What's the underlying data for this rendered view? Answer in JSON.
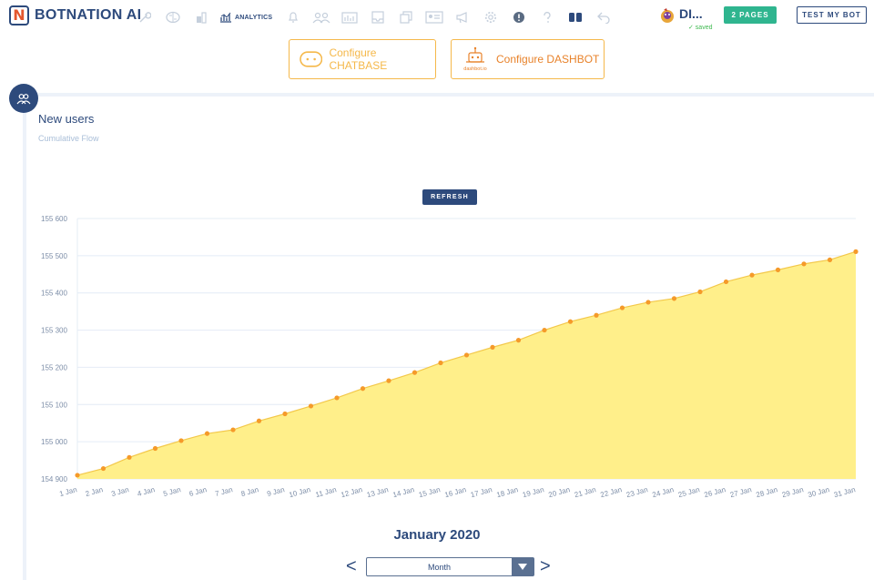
{
  "brand": {
    "name": "BOTNATION AI",
    "mark": "N"
  },
  "toolbar": {
    "analytics_label": "ANALYTICS",
    "bot_name": "DI...",
    "saved_label": "✓ saved",
    "pages_label": "2 PAGES",
    "test_label": "TEST MY BOT",
    "icons": [
      "wrench-icon",
      "brain-icon",
      "building-icon",
      "analytics-icon",
      "bell-icon",
      "team-icon",
      "reports-icon",
      "inbox-icon",
      "documents-icon",
      "contact-card-icon",
      "megaphone-icon",
      "settings-icon",
      "alert-icon",
      "help-icon",
      "toggle-icon",
      "back-icon"
    ]
  },
  "integrations": {
    "chatbase_label": "Configure CHATBASE",
    "dashbot_label": "Configure DASHBOT",
    "dashbot_logo_text": "dashbot.io"
  },
  "card": {
    "title": "New users",
    "subtitle": "Cumulative Flow",
    "refresh_label": "REFRESH"
  },
  "period": {
    "title": "January 2020",
    "select_value": "Month",
    "prev_label": "<",
    "next_label": ">"
  },
  "colors": {
    "primary": "#2d4a7c",
    "accent_green": "#2fb58f",
    "area_fill": "#ffef8a",
    "point": "#f59a2a",
    "chatbase_orange": "#f5b84a",
    "dashbot_orange": "#e8822a"
  },
  "chart_data": {
    "type": "area",
    "title": "",
    "xlabel": "",
    "ylabel": "",
    "ylim": [
      154900,
      155600
    ],
    "yticks": [
      154900,
      155000,
      155100,
      155200,
      155300,
      155400,
      155500,
      155600
    ],
    "ytick_labels": [
      "154 900",
      "155 000",
      "155 100",
      "155 200",
      "155 300",
      "155 400",
      "155 500",
      "155 600"
    ],
    "grid": true,
    "categories": [
      "1 Jan",
      "2 Jan",
      "3 Jan",
      "4 Jan",
      "5 Jan",
      "6 Jan",
      "7 Jan",
      "8 Jan",
      "9 Jan",
      "10 Jan",
      "11 Jan",
      "12 Jan",
      "13 Jan",
      "14 Jan",
      "15 Jan",
      "16 Jan",
      "17 Jan",
      "18 Jan",
      "19 Jan",
      "20 Jan",
      "21 Jan",
      "22 Jan",
      "23 Jan",
      "24 Jan",
      "25 Jan",
      "26 Jan",
      "27 Jan",
      "28 Jan",
      "29 Jan",
      "30 Jan",
      "31 Jan"
    ],
    "series": [
      {
        "values": [
          154910,
          154928,
          154958,
          154982,
          155003,
          155022,
          155032,
          155056,
          155075,
          155096,
          155118,
          155143,
          155164,
          155186,
          155212,
          155233,
          155254,
          155273,
          155300,
          155323,
          155340,
          155360,
          155375,
          155385,
          155403,
          155430,
          155448,
          155462,
          155478,
          155489,
          155511
        ]
      }
    ]
  }
}
